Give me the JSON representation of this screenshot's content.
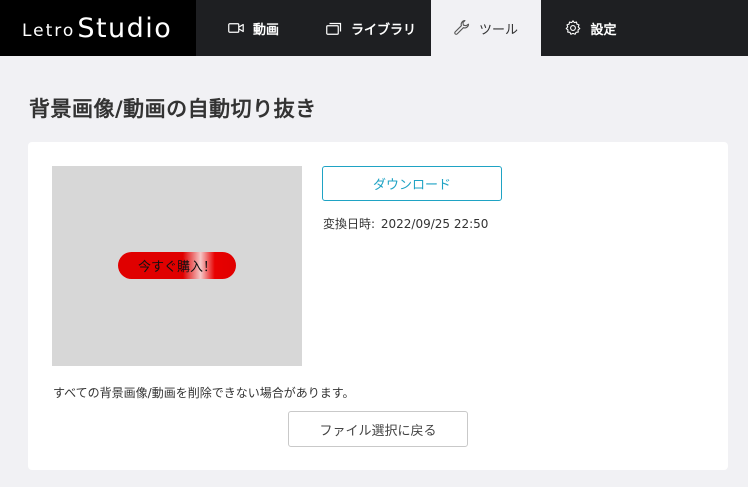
{
  "brand": {
    "part1": "Letro",
    "part2": "Studio"
  },
  "nav": {
    "items": [
      {
        "label": "動画",
        "icon": "video-icon"
      },
      {
        "label": "ライブラリ",
        "icon": "library-icon"
      },
      {
        "label": "ツール",
        "icon": "wrench-icon",
        "active": true
      },
      {
        "label": "設定",
        "icon": "gear-icon"
      }
    ]
  },
  "page": {
    "title": "背景画像/動画の自動切り抜き"
  },
  "result": {
    "preview_badge_text": "今すぐ購入！",
    "download_label": "ダウンロード",
    "converted_label": "変換日時:",
    "converted_value": "2022/09/25 22:50",
    "notice": "すべての背景画像/動画を削除できない場合があります。",
    "back_label": "ファイル選択に戻る"
  },
  "colors": {
    "accent": "#1fa3c4",
    "topbar": "#1e1f22",
    "logo_bg": "#000000",
    "background": "#f1f1f4",
    "badge_red": "#e00000"
  }
}
